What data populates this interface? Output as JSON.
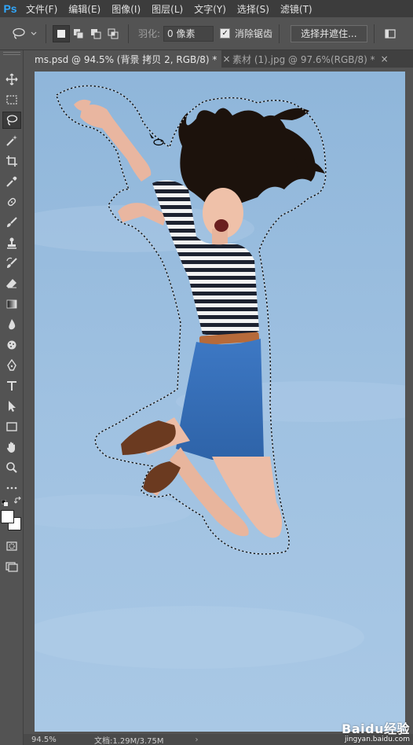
{
  "app": {
    "logo": "Ps"
  },
  "menu": [
    "文件(F)",
    "编辑(E)",
    "图像(I)",
    "图层(L)",
    "文字(Y)",
    "选择(S)",
    "滤镜(T)"
  ],
  "options": {
    "feather_label": "羽化:",
    "feather_value": "0 像素",
    "antialias_checked": true,
    "antialias_label": "消除锯齿",
    "select_mask_label": "选择并遮住..."
  },
  "tabs": [
    {
      "label": "ms.psd @ 94.5% (背景 拷贝 2, RGB/8) *",
      "close": "×",
      "active": true
    },
    {
      "label": "素材 (1).jpg @ 97.6%(RGB/8) *",
      "close": "×",
      "active": false
    }
  ],
  "tools": [
    "move-icon",
    "marquee-icon",
    "lasso-icon",
    "magic-wand-icon",
    "crop-icon",
    "eyedropper-icon",
    "healing-icon",
    "brush-icon",
    "stamp-icon",
    "history-brush-icon",
    "eraser-icon",
    "gradient-icon",
    "blur-icon",
    "dodge-icon",
    "pen-icon",
    "type-icon",
    "path-select-icon",
    "rectangle-icon",
    "hand-icon",
    "zoom-icon",
    "more-icon"
  ],
  "colors": {
    "foreground": "#ffffff",
    "background": "#ffffff",
    "accent": "#31a8ff"
  },
  "status": {
    "zoom": "94.5%",
    "doc": "文档:1.29M/3.75M",
    "arrow": "›"
  },
  "watermark": {
    "brand": "Baidu经验",
    "sub": "jingyan.baidu.com"
  }
}
